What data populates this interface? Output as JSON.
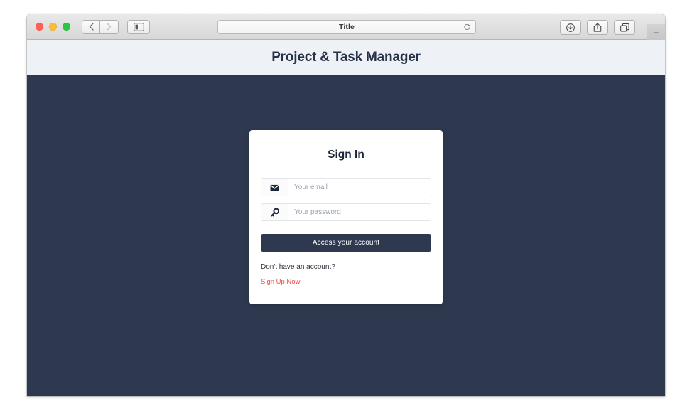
{
  "browser": {
    "traffic_lights": [
      {
        "name": "close",
        "color": "#ff5f57"
      },
      {
        "name": "minimize",
        "color": "#febc2e"
      },
      {
        "name": "maximize",
        "color": "#28c840"
      }
    ],
    "back_icon": "chevron-left-icon",
    "forward_icon": "chevron-right-icon",
    "sidebar_icon": "sidebar-toggle-icon",
    "address": {
      "title": "Title",
      "reload_icon": "reload-icon"
    },
    "tools": [
      {
        "name": "downloads",
        "icon": "download-icon"
      },
      {
        "name": "share",
        "icon": "share-icon"
      },
      {
        "name": "tabs",
        "icon": "tab-overview-icon"
      }
    ],
    "new_tab_label": "+"
  },
  "page": {
    "header_title": "Project & Task Manager",
    "header_bg": "#eef2f6",
    "body_bg": "#2e3950",
    "accent": "#2e3950",
    "link_color": "#e8504a"
  },
  "signin": {
    "title": "Sign In",
    "fields": [
      {
        "name": "email",
        "icon": "envelope-icon",
        "placeholder": "Your email",
        "value": ""
      },
      {
        "name": "password",
        "icon": "key-icon",
        "placeholder": "Your password",
        "value": ""
      }
    ],
    "submit_label": "Access your account",
    "hint": "Don't have an account?",
    "signup_label": "Sign Up Now"
  }
}
